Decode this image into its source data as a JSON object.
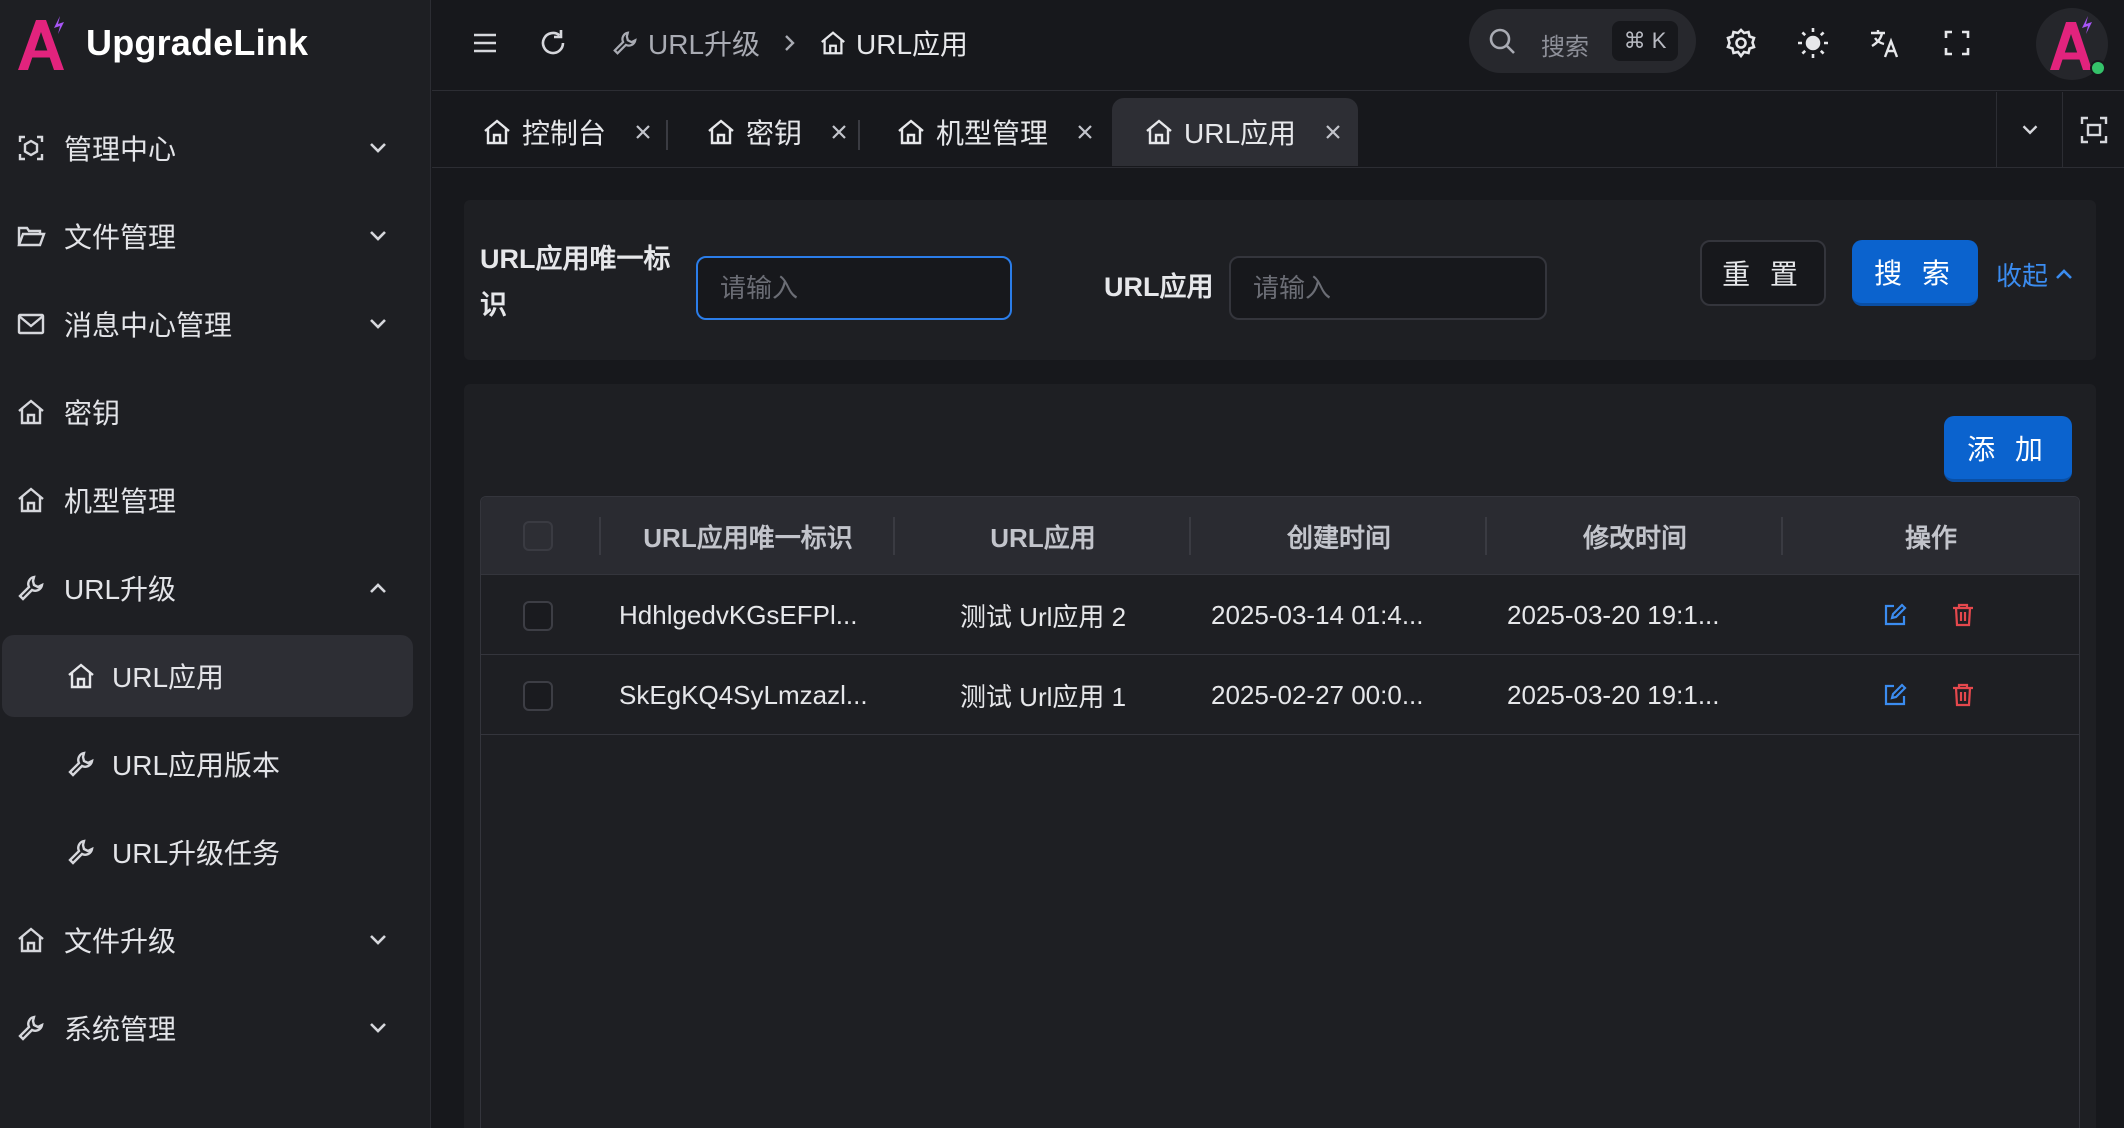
{
  "app": {
    "name": "UpgradeLink"
  },
  "sidebar": {
    "items": [
      {
        "label": "管理中心",
        "icon": "dashboard-icon",
        "expandable": true,
        "expanded": false
      },
      {
        "label": "文件管理",
        "icon": "folder-icon",
        "expandable": true,
        "expanded": false
      },
      {
        "label": "消息中心管理",
        "icon": "mail-icon",
        "expandable": true,
        "expanded": false
      },
      {
        "label": "密钥",
        "icon": "home-icon",
        "expandable": false
      },
      {
        "label": "机型管理",
        "icon": "home-icon",
        "expandable": false
      },
      {
        "label": "URL升级",
        "icon": "wrench-icon",
        "expandable": true,
        "expanded": true,
        "children": [
          {
            "label": "URL应用",
            "icon": "home-icon",
            "active": true
          },
          {
            "label": "URL应用版本",
            "icon": "wrench-icon"
          },
          {
            "label": "URL升级任务",
            "icon": "wrench-icon"
          }
        ]
      },
      {
        "label": "文件升级",
        "icon": "home-icon",
        "expandable": true,
        "expanded": false
      },
      {
        "label": "系统管理",
        "icon": "wrench-icon",
        "expandable": true,
        "expanded": false
      }
    ]
  },
  "header": {
    "breadcrumb": [
      {
        "label": "URL升级",
        "icon": "wrench-icon"
      },
      {
        "label": "URL应用",
        "icon": "home-icon"
      }
    ],
    "search": {
      "label": "搜索",
      "shortcut": "⌘ K"
    }
  },
  "tabs": [
    {
      "label": "控制台",
      "icon": "home-icon",
      "active": false
    },
    {
      "label": "密钥",
      "icon": "home-icon",
      "active": false
    },
    {
      "label": "机型管理",
      "icon": "home-icon",
      "active": false
    },
    {
      "label": "URL应用",
      "icon": "home-icon",
      "active": true
    }
  ],
  "filter": {
    "field1": {
      "label": "URL应用唯一标识",
      "placeholder": "请输入",
      "value": ""
    },
    "field2": {
      "label": "URL应用",
      "placeholder": "请输入",
      "value": ""
    },
    "reset_label": "重 置",
    "search_label": "搜 索",
    "collapse_label": "收起"
  },
  "table": {
    "add_label": "添 加",
    "columns": [
      "URL应用唯一标识",
      "URL应用",
      "创建时间",
      "修改时间",
      "操作"
    ],
    "rows": [
      {
        "id": "HdhlgedvKGsEFPl...",
        "name": "测试 Url应用 2",
        "created": "2025-03-14 01:4...",
        "modified": "2025-03-20 19:1..."
      },
      {
        "id": "SkEgKQ4SyLmzazl...",
        "name": "测试 Url应用 1",
        "created": "2025-02-27 00:0...",
        "modified": "2025-03-20 19:1..."
      }
    ]
  },
  "colors": {
    "accent": "#0b63ce",
    "link": "#3b8cf0",
    "danger": "#e5484d",
    "logo": "#e2237d"
  }
}
